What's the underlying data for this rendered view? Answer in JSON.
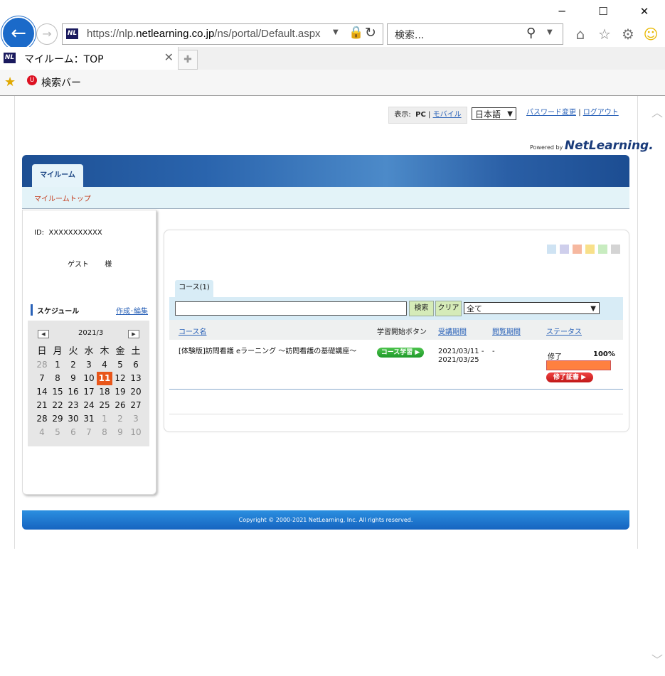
{
  "window": {
    "minimize_icon": "minimize-icon",
    "maximize_icon": "maximize-icon",
    "close_icon": "close-icon"
  },
  "browser": {
    "url_prefix": "https://nlp.",
    "url_domain": "netlearning.co.jp",
    "url_suffix": "/ns/portal/Default.aspx",
    "search_placeholder": "検索...",
    "favicon_text": "NL",
    "tab_title": "マイルーム：TOP",
    "favorites_bar_item": "検索バー"
  },
  "header": {
    "display_label": "表示:",
    "display_pc": "PC",
    "display_sep": "|",
    "display_mobile": "モバイル",
    "language": "日本語",
    "password_link": "パスワード変更",
    "link_sep": "|",
    "logout_link": "ログアウト",
    "powered_by": "Powered by",
    "brand": "NetLearning."
  },
  "nav": {
    "tab_myroom": "マイルーム",
    "sub_myroom_top": "マイルームトップ"
  },
  "profile": {
    "id_label": "ID:",
    "id_value": "XXXXXXXXXXX",
    "name": "ゲスト",
    "honorific": "様"
  },
  "schedule": {
    "title": "スケジュール",
    "edit_link": "作成･編集",
    "month": "2021/3",
    "weekdays": [
      "日",
      "月",
      "火",
      "水",
      "木",
      "金",
      "土"
    ],
    "weeks": [
      [
        "28",
        "1",
        "2",
        "3",
        "4",
        "5",
        "6"
      ],
      [
        "7",
        "8",
        "9",
        "10",
        "11",
        "12",
        "13"
      ],
      [
        "14",
        "15",
        "16",
        "17",
        "18",
        "19",
        "20"
      ],
      [
        "21",
        "22",
        "23",
        "24",
        "25",
        "26",
        "27"
      ],
      [
        "28",
        "29",
        "30",
        "31",
        "1",
        "2",
        "3"
      ],
      [
        "4",
        "5",
        "6",
        "7",
        "8",
        "9",
        "10"
      ]
    ],
    "today": "11"
  },
  "courses": {
    "swatch_colors": [
      "#cfe3f3",
      "#cfcfec",
      "#f6b8a0",
      "#f8e08a",
      "#c8ecc0",
      "#d4d4d4"
    ],
    "tab_label": "コース(1)",
    "search_button": "検索",
    "clear_button": "クリア",
    "filter_value": "全て",
    "columns": [
      "コース名",
      "学習開始ボタン",
      "受講期間",
      "閲覧期間",
      "ステータス"
    ],
    "rows": [
      {
        "name": "[体験版]訪問看護 eラーニング ～訪問看護の基礎講座～",
        "start_button": "コース学習",
        "period_start": "2021/03/11 -",
        "period_end": "2021/03/25",
        "view_period": "-",
        "status": "修了",
        "progress": "100%",
        "progress_value": 100,
        "cert_button": "修了証書"
      }
    ]
  },
  "footer": {
    "copyright": "Copyright © 2000-2021 NetLearning, Inc. All rights reserved."
  }
}
